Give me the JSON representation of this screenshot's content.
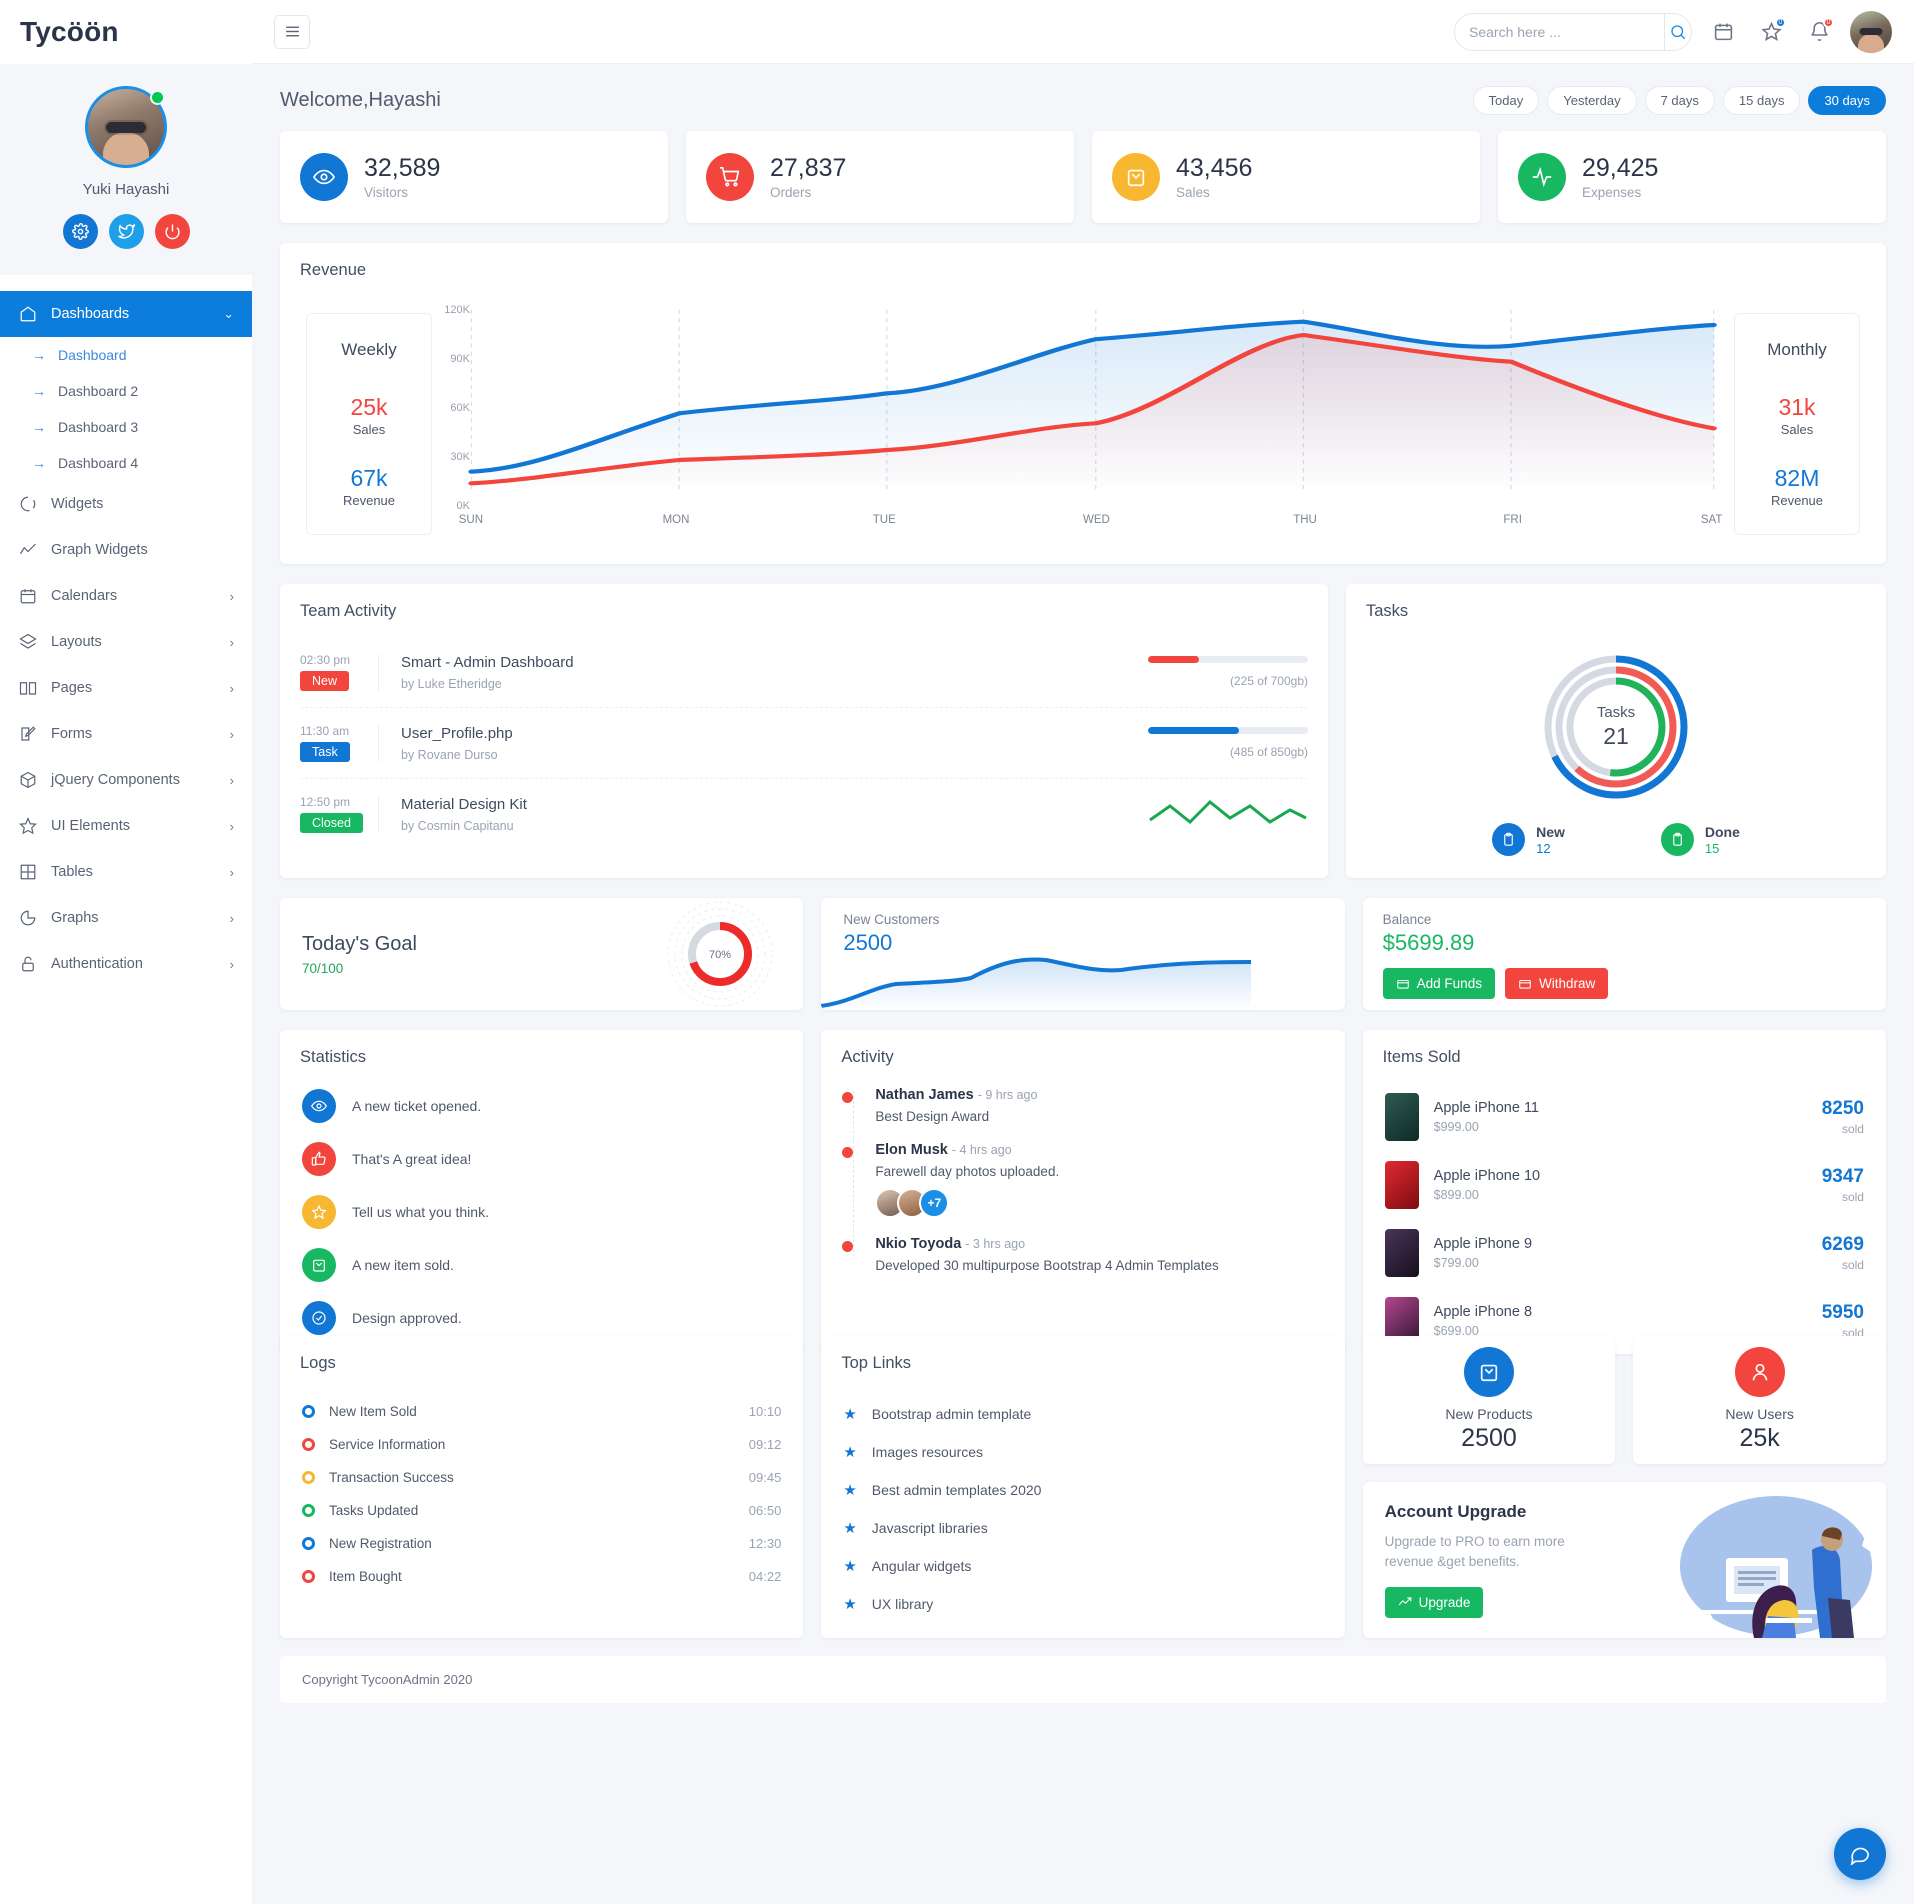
{
  "brand": {
    "name": "Tycöön"
  },
  "profile": {
    "name": "Yuki Hayashi",
    "settings_icon": "gear-icon",
    "twitter_icon": "twitter-icon",
    "power_icon": "power-icon"
  },
  "nav": {
    "items": [
      {
        "label": "Dashboards",
        "icon": "home-icon",
        "active": true,
        "chevron": "⌄"
      },
      {
        "label": "Widgets",
        "icon": "circle-dash-icon",
        "chevron": ""
      },
      {
        "label": "Graph Widgets",
        "icon": "trend-icon",
        "chevron": ""
      },
      {
        "label": "Calendars",
        "icon": "calendar-icon",
        "chevron": "›"
      },
      {
        "label": "Layouts",
        "icon": "layers-icon",
        "chevron": "›"
      },
      {
        "label": "Pages",
        "icon": "book-icon",
        "chevron": "›"
      },
      {
        "label": "Forms",
        "icon": "edit-icon",
        "chevron": "›"
      },
      {
        "label": "jQuery Components",
        "icon": "cube-icon",
        "chevron": "›"
      },
      {
        "label": "UI Elements",
        "icon": "star-icon",
        "chevron": "›"
      },
      {
        "label": "Tables",
        "icon": "table-icon",
        "chevron": "›"
      },
      {
        "label": "Graphs",
        "icon": "pie-icon",
        "chevron": "›"
      },
      {
        "label": "Authentication",
        "icon": "lock-icon",
        "chevron": "›"
      }
    ],
    "sub_items": [
      {
        "label": "Dashboard",
        "current": true
      },
      {
        "label": "Dashboard 2"
      },
      {
        "label": "Dashboard 3"
      },
      {
        "label": "Dashboard 4"
      }
    ]
  },
  "topbar": {
    "menu_icon": "hamburger-icon",
    "search_placeholder": "Search here ...",
    "search_value": "",
    "search_icon": "search-icon",
    "calendar_icon": "calendar-icon",
    "star_icon": "star-icon",
    "bell_icon": "bell-icon",
    "star_badge": "0",
    "bell_badge": "0",
    "avatar": "user-avatar"
  },
  "header": {
    "welcome": "Welcome,Hayashi",
    "filters": [
      {
        "label": "Today",
        "active": false
      },
      {
        "label": "Yesterday",
        "active": false
      },
      {
        "label": "7 days",
        "active": false
      },
      {
        "label": "15 days",
        "active": false
      },
      {
        "label": "30 days",
        "active": true
      }
    ]
  },
  "stats": [
    {
      "value": "32,589",
      "label": "Visitors",
      "color": "#1277d4",
      "icon": "eye-icon"
    },
    {
      "value": "27,837",
      "label": "Orders",
      "color": "#f2453d",
      "icon": "cart-icon"
    },
    {
      "value": "43,456",
      "label": "Sales",
      "color": "#f7b731",
      "icon": "bag-icon"
    },
    {
      "value": "29,425",
      "label": "Expenses",
      "color": "#17b861",
      "icon": "activity-icon"
    }
  ],
  "revenue": {
    "title": "Revenue",
    "weekly": {
      "head": "Weekly",
      "sales": "25k",
      "sales_label": "Sales",
      "revenue": "67k",
      "revenue_label": "Revenue"
    },
    "monthly": {
      "head": "Monthly",
      "sales": "31k",
      "sales_label": "Sales",
      "revenue": "82M",
      "revenue_label": "Revenue"
    }
  },
  "chart_data": {
    "type": "area",
    "title": "Revenue",
    "xlabel": "",
    "ylabel": "",
    "categories": [
      "SUN",
      "MON",
      "TUE",
      "WED",
      "THU",
      "FRI",
      "SAT"
    ],
    "yticks": [
      "0K",
      "30K",
      "60K",
      "90K",
      "120K"
    ],
    "ylim": [
      0,
      120000
    ],
    "grid": "vertical-dashed",
    "legend": "none",
    "series": [
      {
        "name": "Revenue",
        "color": "#1277d4",
        "values": [
          12000,
          48000,
          59000,
          98000,
          109000,
          94000,
          105000
        ]
      },
      {
        "name": "Sales",
        "color": "#f2453d",
        "values": [
          8000,
          27000,
          32000,
          51000,
          90000,
          81000,
          47000
        ]
      }
    ]
  },
  "team_activity": {
    "title": "Team Activity",
    "rows": [
      {
        "time": "02:30 pm",
        "tag": "New",
        "tag_color": "#f2453d",
        "name": "Smart - Admin Dashboard",
        "by": "by Luke Etheridge",
        "progress": 32,
        "bar_color": "#f2453d",
        "caption": "(225 of 700gb)",
        "viz": "bar"
      },
      {
        "time": "11:30 am",
        "tag": "Task",
        "tag_color": "#1277d4",
        "name": "User_Profile.php",
        "by": "by Rovane Durso",
        "progress": 57,
        "bar_color": "#1277d4",
        "caption": "(485 of 850gb)",
        "viz": "bar"
      },
      {
        "time": "12:50 pm",
        "tag": "Closed",
        "tag_color": "#17b861",
        "name": "Material Design Kit",
        "by": "by Cosmin Capitanu",
        "progress": 0,
        "bar_color": "#17b861",
        "caption": "",
        "viz": "spark"
      }
    ]
  },
  "tasks": {
    "title": "Tasks",
    "center_label": "Tasks",
    "center_value": "21",
    "rings": [
      {
        "name": "outer",
        "color": "#1277d4",
        "percent": 68
      },
      {
        "name": "middle",
        "color": "#f2453d",
        "percent": 62
      },
      {
        "name": "inner",
        "color": "#17b861",
        "percent": 52
      }
    ],
    "legend": [
      {
        "label": "New",
        "value": "12",
        "color": "#1277d4",
        "icon": "clipboard-icon"
      },
      {
        "label": "Done",
        "value": "15",
        "color": "#17b861",
        "icon": "clipboard-icon"
      }
    ]
  },
  "goal": {
    "title": "Today's Goal",
    "sub": "70/100",
    "percent": "70%",
    "percent_value": 70,
    "color": "#f2453d"
  },
  "new_customers": {
    "title": "New Customers",
    "value": "2500",
    "color": "#1277d4"
  },
  "balance": {
    "title": "Balance",
    "value": "$5699.89",
    "add_label": "Add Funds",
    "withdraw_label": "Withdraw",
    "add_color": "#17b861",
    "withdraw_color": "#f2453d",
    "add_icon": "wallet-icon",
    "withdraw_icon": "card-icon"
  },
  "statistics": {
    "title": "Statistics",
    "rows": [
      {
        "text": "A new ticket opened.",
        "color": "#1277d4",
        "icon": "eye-icon"
      },
      {
        "text": "That's A great idea!",
        "color": "#f2453d",
        "icon": "thumbs-up-icon"
      },
      {
        "text": "Tell us what you think.",
        "color": "#f7b731",
        "icon": "star-icon"
      },
      {
        "text": "A new item sold.",
        "color": "#17b861",
        "icon": "bag-icon"
      },
      {
        "text": "Design approved.",
        "color": "#1277d4",
        "icon": "check-circle-icon"
      }
    ]
  },
  "activity": {
    "title": "Activity",
    "items": [
      {
        "name": "Nathan James",
        "time": "- 9 hrs ago",
        "body": "Best Design Award",
        "faces": []
      },
      {
        "name": "Elon Musk",
        "time": "- 4 hrs ago",
        "body": "Farewell day photos uploaded.",
        "faces": [
          "face-1",
          "face-2"
        ],
        "more": "+7"
      },
      {
        "name": "Nkio Toyoda",
        "time": "- 3 hrs ago",
        "body": "Developed 30 multipurpose Bootstrap 4 Admin Templates",
        "faces": []
      }
    ]
  },
  "items_sold": {
    "title": "Items Sold",
    "sold_label": "sold",
    "rows": [
      {
        "name": "Apple iPhone 11",
        "price": "$999.00",
        "count": "8250",
        "thumb": "#1f4a42"
      },
      {
        "name": "Apple iPhone 10",
        "price": "$899.00",
        "count": "9347",
        "thumb": "#b8141a"
      },
      {
        "name": "Apple iPhone 9",
        "price": "$799.00",
        "count": "6269",
        "thumb": "#2a1f33"
      },
      {
        "name": "Apple iPhone 8",
        "price": "$699.00",
        "count": "5950",
        "thumb": "#35263b"
      }
    ]
  },
  "logs": {
    "title": "Logs",
    "rows": [
      {
        "text": "New Item Sold",
        "time": "10:10",
        "color": "#1277d4"
      },
      {
        "text": "Service Information",
        "time": "09:12",
        "color": "#f2453d"
      },
      {
        "text": "Transaction Success",
        "time": "09:45",
        "color": "#f7b731"
      },
      {
        "text": "Tasks Updated",
        "time": "06:50",
        "color": "#17b861"
      },
      {
        "text": "New Registration",
        "time": "12:30",
        "color": "#1277d4"
      },
      {
        "text": "Item Bought",
        "time": "04:22",
        "color": "#f2453d"
      }
    ]
  },
  "top_links": {
    "title": "Top Links",
    "rows": [
      {
        "text": "Bootstrap admin template"
      },
      {
        "text": "Images resources"
      },
      {
        "text": "Best admin templates 2020"
      },
      {
        "text": "Javascript libraries"
      },
      {
        "text": "Angular widgets"
      },
      {
        "text": "UX library"
      }
    ]
  },
  "mini_cards": [
    {
      "label": "New Products",
      "value": "2500",
      "color": "#1277d4",
      "icon": "bag-icon"
    },
    {
      "label": "New Users",
      "value": "25k",
      "color": "#f2453d",
      "icon": "user-icon"
    }
  ],
  "upgrade": {
    "title": "Account Upgrade",
    "desc": "Upgrade to PRO to earn more revenue &get benefits.",
    "button": "Upgrade",
    "button_color": "#17b861",
    "button_icon": "trend-up-icon"
  },
  "footer": {
    "text": "Copyright TycoonAdmin 2020"
  },
  "chat": {
    "icon": "chat-icon"
  }
}
